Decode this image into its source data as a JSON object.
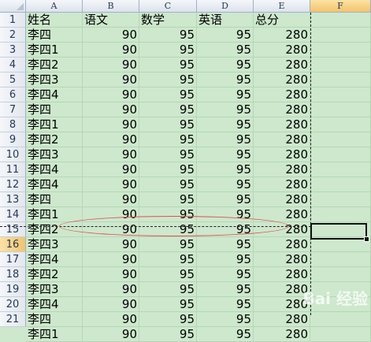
{
  "columns": [
    "A",
    "B",
    "C",
    "D",
    "E",
    "F"
  ],
  "selected_column": "F",
  "selected_row": 16,
  "row_numbers": [
    1,
    2,
    3,
    4,
    5,
    6,
    7,
    8,
    9,
    10,
    11,
    12,
    13,
    14,
    15,
    16,
    17,
    18,
    19,
    20,
    21
  ],
  "header_row": [
    "姓名",
    "语文",
    "数学",
    "英语",
    "总分"
  ],
  "rows": [
    [
      "李四",
      90,
      95,
      95,
      280
    ],
    [
      "李四1",
      90,
      95,
      95,
      280
    ],
    [
      "李四2",
      90,
      95,
      95,
      280
    ],
    [
      "李四3",
      90,
      95,
      95,
      280
    ],
    [
      "李四4",
      90,
      95,
      95,
      280
    ],
    [
      "李四",
      90,
      95,
      95,
      280
    ],
    [
      "李四1",
      90,
      95,
      95,
      280
    ],
    [
      "李四2",
      90,
      95,
      95,
      280
    ],
    [
      "李四3",
      90,
      95,
      95,
      280
    ],
    [
      "李四4",
      90,
      95,
      95,
      280
    ],
    [
      "李四4",
      90,
      95,
      95,
      280
    ],
    [
      "李四",
      90,
      95,
      95,
      280
    ],
    [
      "李四1",
      90,
      95,
      95,
      280
    ],
    [
      "李四2",
      90,
      95,
      95,
      280
    ],
    [
      "李四3",
      90,
      95,
      95,
      280
    ],
    [
      "李四4",
      90,
      95,
      95,
      280
    ],
    [
      "李四2",
      90,
      95,
      95,
      280
    ],
    [
      "李四3",
      90,
      95,
      95,
      280
    ],
    [
      "李四4",
      90,
      95,
      95,
      280
    ],
    [
      "李四",
      90,
      95,
      95,
      280
    ],
    [
      "李四1",
      90,
      95,
      95,
      280
    ]
  ],
  "watermark": "Bai 经验",
  "colors": {
    "sheet_background": "#cde8cd",
    "header_background": "#dde3ec",
    "selected_header": "#f2c46a",
    "annotation_ellipse": "#e05050"
  }
}
